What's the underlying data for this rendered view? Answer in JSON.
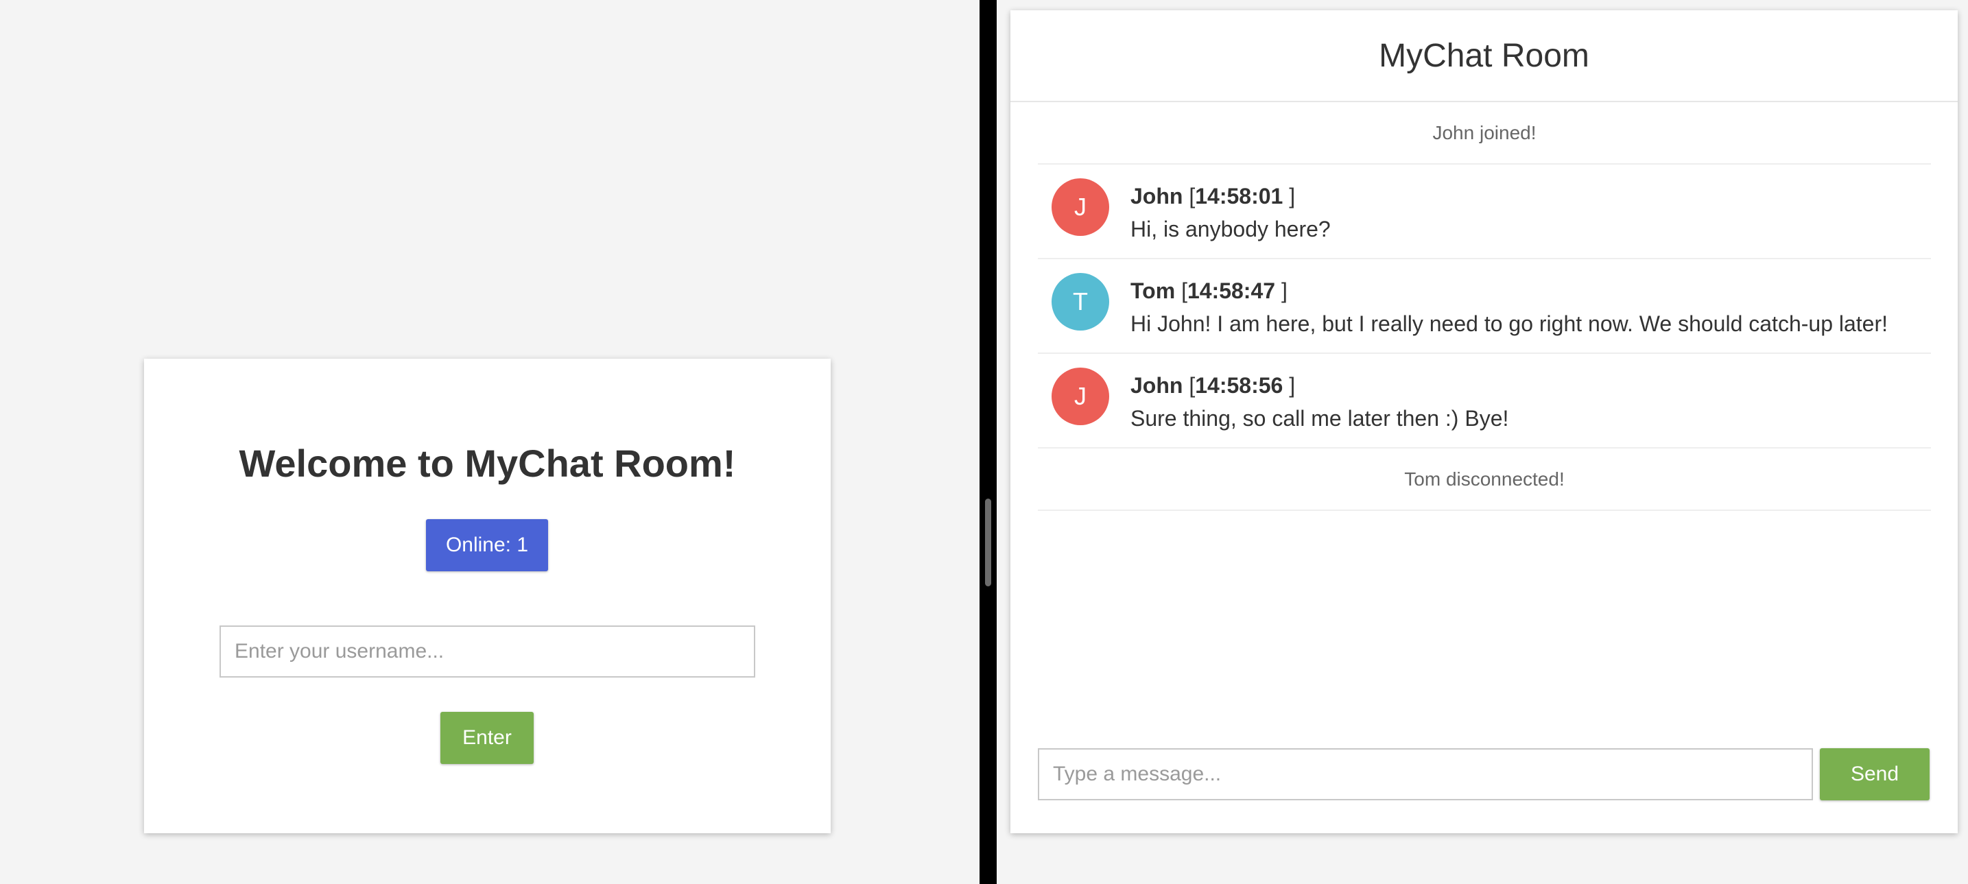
{
  "welcome": {
    "title": "Welcome to MyChat Room!",
    "online_label": "Online: 1",
    "username_placeholder": "Enter your username...",
    "enter_label": "Enter"
  },
  "chat": {
    "title": "MyChat Room",
    "message_placeholder": "Type a message...",
    "send_label": "Send",
    "items": [
      {
        "kind": "event",
        "text": "John joined!"
      },
      {
        "kind": "message",
        "avatar": "J",
        "avatar_color": "#ec5e56",
        "sender": "John",
        "time_open": " [",
        "time": "14:58:01",
        "time_close": " ]",
        "text": "Hi, is anybody here?"
      },
      {
        "kind": "message",
        "avatar": "T",
        "avatar_color": "#56bcd3",
        "sender": "Tom",
        "time_open": " [",
        "time": "14:58:47",
        "time_close": " ]",
        "text": "Hi John! I am here, but I really need to go right now. We should catch-up later!"
      },
      {
        "kind": "message",
        "avatar": "J",
        "avatar_color": "#ec5e56",
        "sender": "John",
        "time_open": " [",
        "time": "14:58:56",
        "time_close": " ]",
        "text": "Sure thing, so call me later then :) Bye!"
      },
      {
        "kind": "event",
        "text": "Tom disconnected!"
      }
    ]
  },
  "colors": {
    "background": "#f4f4f4",
    "online_badge": "#4a63d6",
    "button_green": "#7ab04f",
    "divider": "#000000"
  }
}
